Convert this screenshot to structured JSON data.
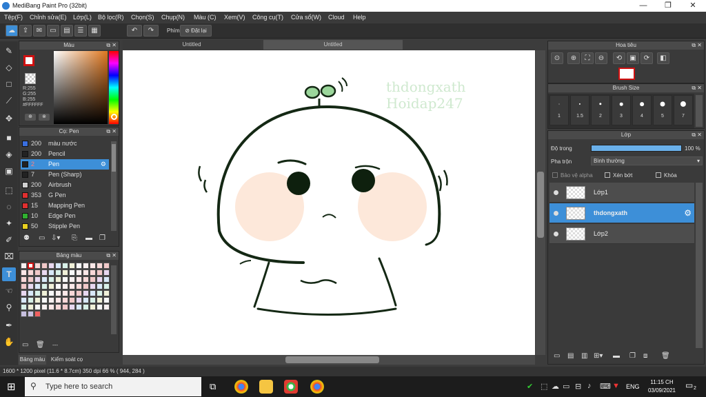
{
  "window": {
    "title": "MediBang Paint Pro (32bit)",
    "minimize": "—",
    "maximize": "❐",
    "close": "✕"
  },
  "menu": [
    "Tệp(F)",
    "Chỉnh sửa(E)",
    "Lớp(L)",
    "Bộ lọc(R)",
    "Chọn(S)",
    "Chụp(N)",
    "Màu (C)",
    "Xem(V)",
    "Công cụ(T)",
    "Cửa sổ(W)",
    "Cloud",
    "Help"
  ],
  "toolbar": {
    "shortcut_label": "Phím",
    "reset_label": "Đặt lại"
  },
  "color_panel": {
    "title": "Màu",
    "r": "R:255",
    "g": "G:255",
    "b": "B:255",
    "hex": "#FFFFFF"
  },
  "brush_panel": {
    "title": "Cọ: Pen",
    "items": [
      {
        "size": "200",
        "name": "màu nước",
        "color": "#3a6fe0"
      },
      {
        "size": "200",
        "name": "Pencil",
        "color": "#222222"
      },
      {
        "size": "2",
        "name": "Pen",
        "color": "#222222"
      },
      {
        "size": "7",
        "name": "Pen (Sharp)",
        "color": "#222222"
      },
      {
        "size": "200",
        "name": "Airbrush",
        "color": "#d0d0d0"
      },
      {
        "size": "353",
        "name": "G Pen",
        "color": "#e03030"
      },
      {
        "size": "15",
        "name": "Mapping Pen",
        "color": "#e03030"
      },
      {
        "size": "10",
        "name": "Edge Pen",
        "color": "#30b030"
      },
      {
        "size": "50",
        "name": "Stipple Pen",
        "color": "#e8d020"
      }
    ]
  },
  "palette_panel": {
    "title": "Bảng màu",
    "footer": "---"
  },
  "bottom_tabs": [
    "Bảng màu",
    "Kiểm soát cọ"
  ],
  "canvas_tabs": [
    "Untitled",
    "Untitled"
  ],
  "watermark": {
    "line1": "thdongxath",
    "line2": "Hoidap247"
  },
  "navigator": {
    "title": "Hoa tiêu"
  },
  "brush_size_panel": {
    "title": "Brush Size",
    "sizes": [
      "1",
      "1.5",
      "2",
      "3",
      "4",
      "5",
      "7"
    ]
  },
  "layers_panel": {
    "title": "Lớp",
    "opacity_label": "Độ trong",
    "opacity_value": "100 %",
    "opacity_fraction": 1.0,
    "blend_label": "Pha trộn",
    "blend_value": "Bình thường",
    "protect_alpha": "Bảo vệ alpha",
    "clipping": "Xén bớt",
    "lock": "Khóa",
    "layers": [
      {
        "name": "Lớp1",
        "selected": false
      },
      {
        "name": "thdongxath",
        "selected": true
      },
      {
        "name": "Lớp2",
        "selected": false
      }
    ]
  },
  "status": {
    "text": "1600 * 1200 pixel   (11.6 * 8.7cm)   350 dpi   66 %   ( 944, 284 )"
  },
  "taskbar": {
    "search_placeholder": "Type here to search",
    "lang": "ENG",
    "time": "11:15 CH",
    "date": "03/09/2021",
    "notif": "2"
  }
}
